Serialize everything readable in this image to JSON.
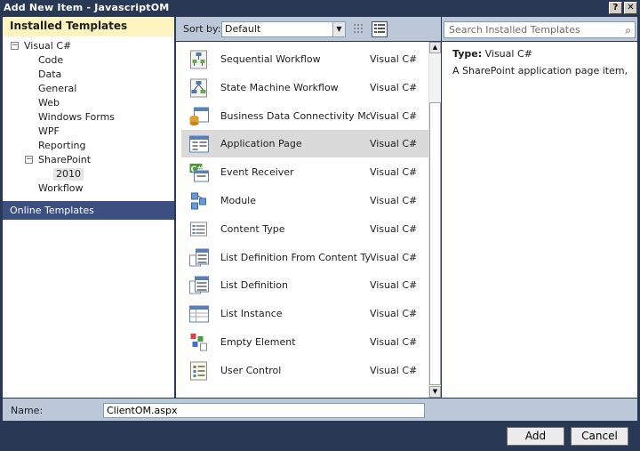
{
  "window": {
    "title": "Add New Item - JavascriptOM",
    "help_label": "?",
    "close_label": "✕"
  },
  "left": {
    "header": "Installed Templates",
    "tree": {
      "root_label": "Visual C#",
      "root_expander": "−",
      "children": [
        "Code",
        "Data",
        "General",
        "Web",
        "Windows Forms",
        "WPF",
        "Reporting"
      ],
      "sharepoint_label": "SharePoint",
      "sharepoint_expander": "−",
      "sharepoint_child": "2010",
      "workflow_label": "Workflow"
    },
    "online_label": "Online Templates"
  },
  "toolbar": {
    "sort_label": "Sort by:",
    "sort_value": "Default",
    "search_placeholder": "Search Installed Templates"
  },
  "templates": [
    {
      "name": "Sequential Workflow",
      "lang": "Visual C#",
      "icon": "sequential-workflow-icon"
    },
    {
      "name": "State Machine Workflow",
      "lang": "Visual C#",
      "icon": "state-machine-workflow-icon"
    },
    {
      "name": "Business Data Connectivity Mo···",
      "lang": "Visual C#",
      "icon": "bdc-model-icon"
    },
    {
      "name": "Application Page",
      "lang": "Visual C#",
      "icon": "application-page-icon"
    },
    {
      "name": "Event Receiver",
      "lang": "Visual C#",
      "icon": "event-receiver-icon"
    },
    {
      "name": "Module",
      "lang": "Visual C#",
      "icon": "module-icon"
    },
    {
      "name": "Content Type",
      "lang": "Visual C#",
      "icon": "content-type-icon"
    },
    {
      "name": "List Definition From Content Type",
      "lang": "Visual C#",
      "icon": "list-definition-from-content-type-icon"
    },
    {
      "name": "List Definition",
      "lang": "Visual C#",
      "icon": "list-definition-icon"
    },
    {
      "name": "List Instance",
      "lang": "Visual C#",
      "icon": "list-instance-icon"
    },
    {
      "name": "Empty Element",
      "lang": "Visual C#",
      "icon": "empty-element-icon"
    },
    {
      "name": "User Control",
      "lang": "Visual C#",
      "icon": "user-control-icon"
    }
  ],
  "selected_index": 3,
  "details": {
    "type_label": "Type:",
    "type_value": "Visual C#",
    "description": "A SharePoint application page item,"
  },
  "name_field": {
    "label": "Name:",
    "value": "ClientOM.aspx"
  },
  "buttons": {
    "add": "Add",
    "cancel": "Cancel"
  }
}
